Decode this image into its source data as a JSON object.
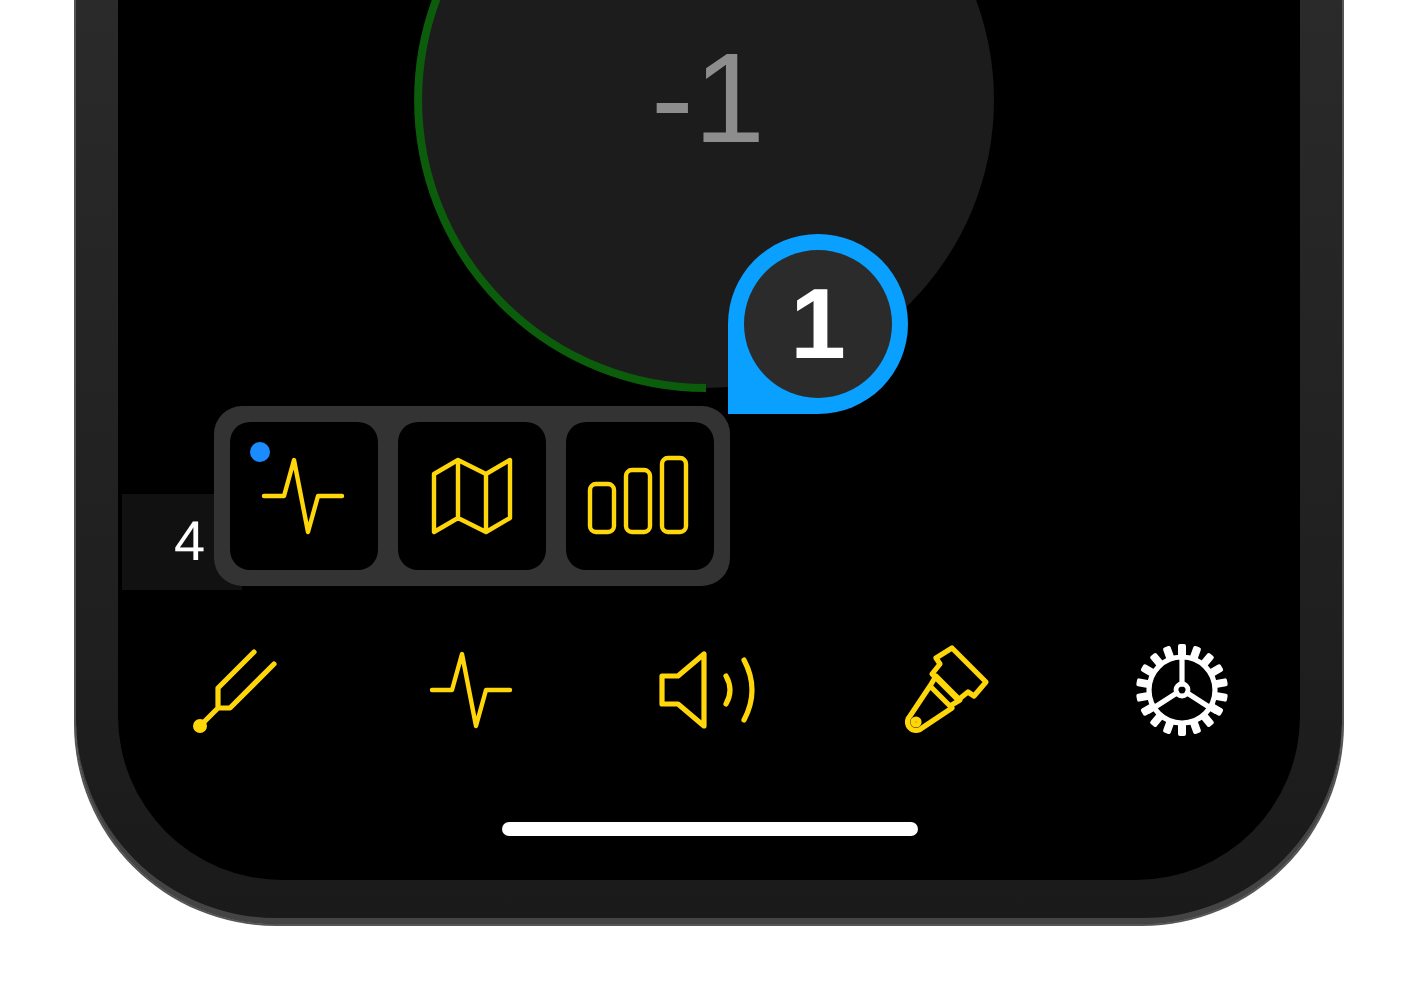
{
  "tuner": {
    "reading": "-1"
  },
  "badge": {
    "text": "1"
  },
  "side_value": {
    "text": "4"
  },
  "popup": {
    "items": [
      {
        "kind": "pulse",
        "indicator": true
      },
      {
        "kind": "map",
        "indicator": false
      },
      {
        "kind": "bars",
        "indicator": false
      }
    ]
  },
  "tab_bar": {
    "items": [
      {
        "kind": "tuning-fork",
        "selected": false
      },
      {
        "kind": "pulse",
        "selected": false
      },
      {
        "kind": "speaker",
        "selected": false
      },
      {
        "kind": "brush",
        "selected": false
      },
      {
        "kind": "gear",
        "selected": true
      }
    ]
  }
}
